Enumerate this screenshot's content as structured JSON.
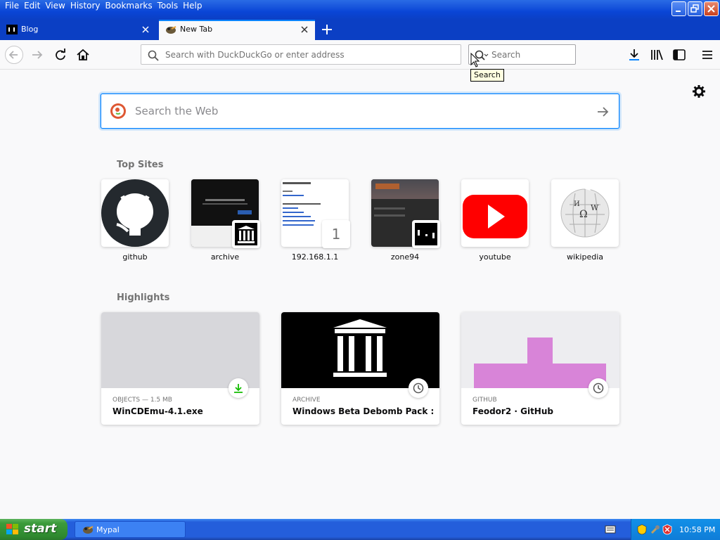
{
  "menu": [
    "File",
    "Edit",
    "View",
    "History",
    "Bookmarks",
    "Tools",
    "Help"
  ],
  "tabs": [
    {
      "label": "Blog"
    },
    {
      "label": "New Tab"
    }
  ],
  "urlbar": {
    "placeholder": "Search with DuckDuckGo or enter address"
  },
  "searchbar": {
    "placeholder": "Search"
  },
  "tooltip": "Search",
  "content": {
    "search_placeholder": "Search the Web",
    "top_sites_title": "Top Sites",
    "highlights_title": "Highlights"
  },
  "top_sites": [
    {
      "label": "github",
      "icon": "github-logo"
    },
    {
      "label": "archive",
      "icon": "archive-logo"
    },
    {
      "label": "192.168.1.1",
      "badge": "1"
    },
    {
      "label": "zone94",
      "icon": "zone94-logo"
    },
    {
      "label": "youtube",
      "icon": "youtube-logo"
    },
    {
      "label": "wikipedia",
      "icon": "wikipedia-logo"
    }
  ],
  "highlights": [
    {
      "source": "OBJECTS — 1.5 MB",
      "title": "WinCDEmu-4.1.exe",
      "context_icon": "download-icon"
    },
    {
      "source": "ARCHIVE",
      "title": "Windows Beta Debomb Pack : W...",
      "context_icon": "clock-icon"
    },
    {
      "source": "GITHUB",
      "title": "Feodor2 · GitHub",
      "context_icon": "clock-icon"
    }
  ],
  "taskbar": {
    "start_label": "start",
    "window_label": "Mypal",
    "clock": "10:58 PM"
  },
  "colors": {
    "accent": "#0a84ff",
    "titlebar": "#0a45d6",
    "taskbar": "#245edb",
    "start": "#3c9b3b",
    "youtube": "#ff0000",
    "feodor": "#d884d8"
  }
}
